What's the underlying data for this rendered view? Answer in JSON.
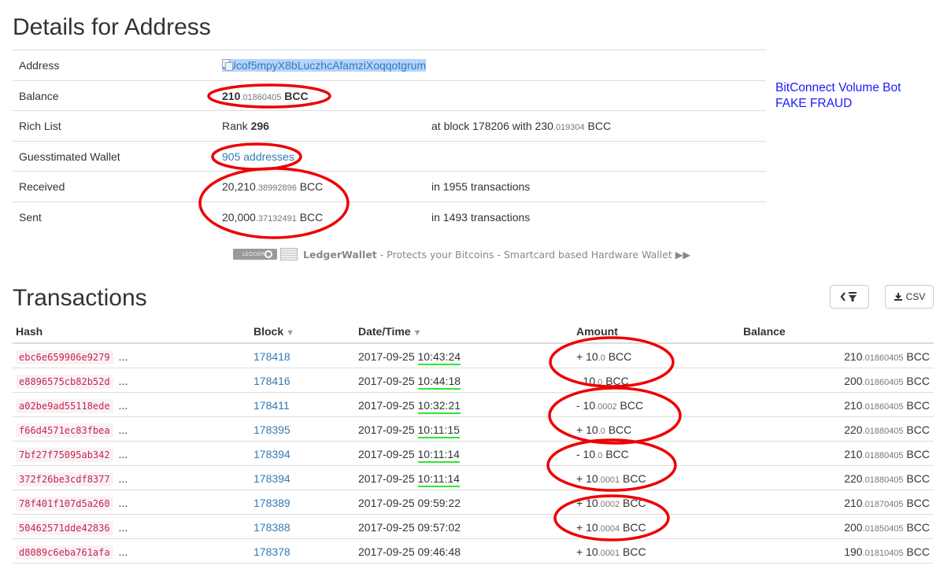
{
  "page_title": "Details for Address",
  "details": {
    "address": {
      "label": "Address",
      "value": "8Ucof5mpyX8bLuczhcAfamziXoqqotgrum"
    },
    "balance": {
      "label": "Balance",
      "int": "210",
      "dec": ".01860405",
      "unit": " BCC"
    },
    "rich_list": {
      "label": "Rich List",
      "rank_prefix": "Rank ",
      "rank": "296",
      "extra_prefix": "at block 178206 with 230",
      "extra_dec": ".019304",
      "extra_unit": " BCC"
    },
    "wallet": {
      "label": "Guesstimated Wallet",
      "value": "905 addresses"
    },
    "received": {
      "label": "Received",
      "int": "20,210",
      "dec": ".38992896",
      "unit": " BCC",
      "extra": "in 1955 transactions"
    },
    "sent": {
      "label": "Sent",
      "int": "20,000",
      "dec": ".37132491",
      "unit": " BCC",
      "extra": "in 1493 transactions"
    }
  },
  "annotation": {
    "line1": "BitConnect Volume Bot",
    "line2": "FAKE FRAUD",
    "color": "#1a1aff"
  },
  "ledger": {
    "logo_text": "LEDGER",
    "name": "LedgerWallet",
    "tagline": " - Protects your Bitcoins - Smartcard based Hardware Wallet ▶▶"
  },
  "transactions": {
    "title": "Transactions",
    "filter_icon": "filter-icon",
    "csv_label": "CSV",
    "headers": {
      "hash": "Hash",
      "block": "Block",
      "date": "Date/Time",
      "amount": "Amount",
      "balance": "Balance"
    },
    "rows": [
      {
        "hash": "ebc6e659906e9279",
        "block": "178418",
        "date": "2017-09-25 ",
        "time": "10:43:24",
        "amt_int": "+ 10",
        "amt_dec": ".0",
        "bal_int": "210",
        "bal_dec": ".01860405"
      },
      {
        "hash": "e8896575cb82b52d",
        "block": "178416",
        "date": "2017-09-25 ",
        "time": "10:44:18",
        "amt_int": "- 10",
        "amt_dec": ".0",
        "bal_int": "200",
        "bal_dec": ".01860405"
      },
      {
        "hash": "a02be9ad55118ede",
        "block": "178411",
        "date": "2017-09-25 ",
        "time": "10:32:21",
        "amt_int": "- 10",
        "amt_dec": ".0002",
        "bal_int": "210",
        "bal_dec": ".01860405"
      },
      {
        "hash": "f66d4571ec83fbea",
        "block": "178395",
        "date": "2017-09-25 ",
        "time": "10:11:15",
        "amt_int": "+ 10",
        "amt_dec": ".0",
        "bal_int": "220",
        "bal_dec": ".01880405"
      },
      {
        "hash": "7bf27f75095ab342",
        "block": "178394",
        "date": "2017-09-25 ",
        "time": "10:11:14",
        "amt_int": "- 10",
        "amt_dec": ".0",
        "bal_int": "210",
        "bal_dec": ".01880405"
      },
      {
        "hash": "372f26be3cdf8377",
        "block": "178394",
        "date": "2017-09-25 ",
        "time": "10:11:14",
        "amt_int": "+ 10",
        "amt_dec": ".0001",
        "bal_int": "220",
        "bal_dec": ".01880405"
      },
      {
        "hash": "78f401f107d5a260",
        "block": "178389",
        "date": "2017-09-25 ",
        "time": "09:59:22",
        "amt_int": "+ 10",
        "amt_dec": ".0002",
        "bal_int": "210",
        "bal_dec": ".01870405"
      },
      {
        "hash": "50462571dde42836",
        "block": "178388",
        "date": "2017-09-25 ",
        "time": "09:57:02",
        "amt_int": "+ 10",
        "amt_dec": ".0004",
        "bal_int": "200",
        "bal_dec": ".01850405"
      },
      {
        "hash": "d8089c6eba761afa",
        "block": "178378",
        "date": "2017-09-25 ",
        "time": "09:46:48",
        "amt_int": "+ 10",
        "amt_dec": ".0001",
        "bal_int": "190",
        "bal_dec": ".01810405"
      }
    ],
    "unit": " BCC",
    "ellipsis": " ..."
  },
  "markup_colors": {
    "circle": "#ee0000",
    "underline": "#2ee62e"
  }
}
